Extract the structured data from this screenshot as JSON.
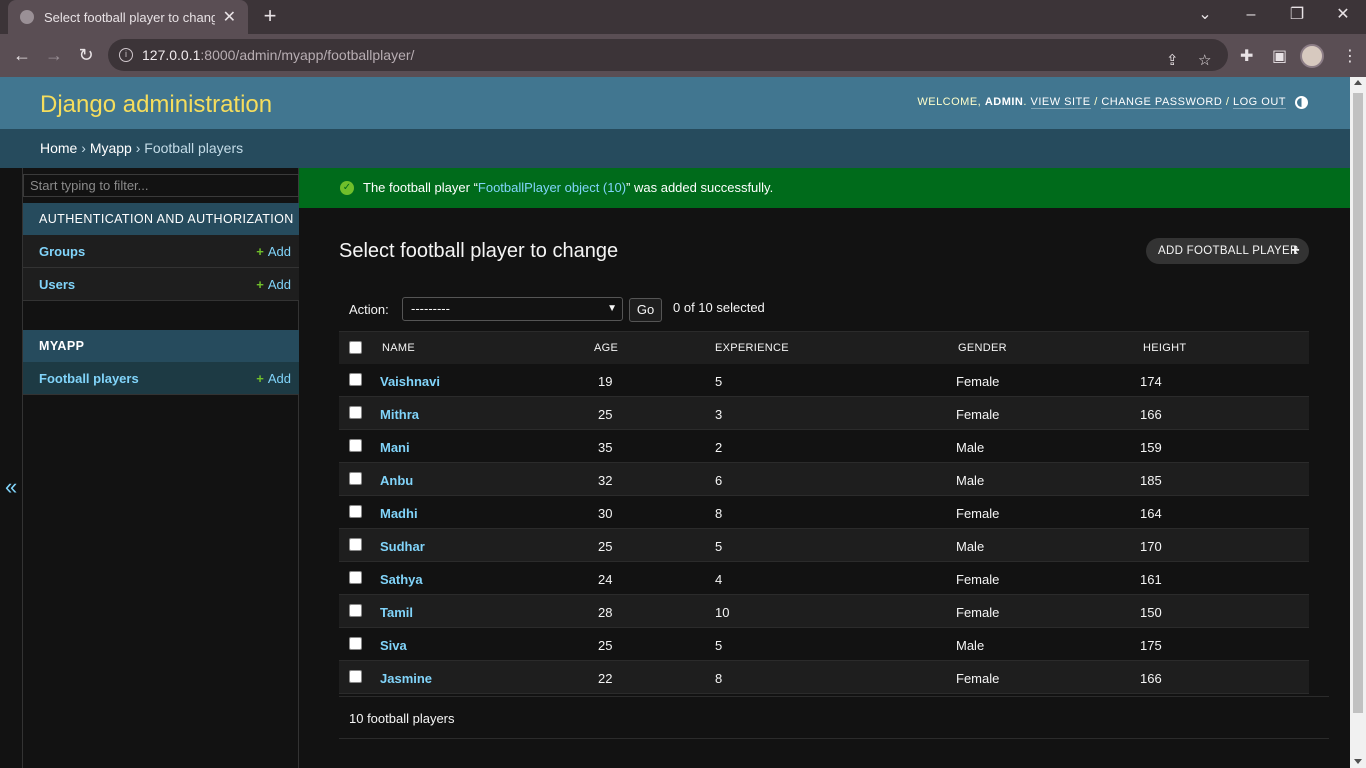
{
  "browser": {
    "tab_title": "Select football player to change",
    "url_host": "127.0.0.1",
    "url_path": ":8000/admin/myapp/footballplayer/"
  },
  "header": {
    "branding": "Django administration",
    "welcome": "WELCOME,",
    "username": "ADMIN",
    "view_site": "VIEW SITE",
    "change_password": "CHANGE PASSWORD",
    "logout": "LOG OUT",
    "sep": "/"
  },
  "breadcrumbs": {
    "home": "Home",
    "app": "Myapp",
    "current": "Football players",
    "sep": "›"
  },
  "sidebar": {
    "filter_placeholder": "Start typing to filter...",
    "toggle_glyph": "«",
    "modules": [
      {
        "caption": "AUTHENTICATION AND AUTHORIZATION",
        "rows": [
          {
            "name": "Groups",
            "add": "Add"
          },
          {
            "name": "Users",
            "add": "Add"
          }
        ]
      },
      {
        "caption": "MYAPP",
        "rows": [
          {
            "name": "Football players",
            "add": "Add"
          }
        ]
      }
    ]
  },
  "message": {
    "prefix": "The football player “",
    "link": "FootballPlayer object (10)",
    "suffix": "” was added successfully."
  },
  "main": {
    "title": "Select football player to change",
    "add_button": "ADD FOOTBALL PLAYER",
    "action_label": "Action:",
    "action_value": "---------",
    "go": "Go",
    "selected_count": "0 of 10 selected",
    "columns": [
      "NAME",
      "AGE",
      "EXPERIENCE",
      "GENDER",
      "HEIGHT"
    ],
    "rows": [
      {
        "name": "Vaishnavi",
        "age": "19",
        "experience": "5",
        "gender": "Female",
        "height": "174"
      },
      {
        "name": "Mithra",
        "age": "25",
        "experience": "3",
        "gender": "Female",
        "height": "166"
      },
      {
        "name": "Mani",
        "age": "35",
        "experience": "2",
        "gender": "Male",
        "height": "159"
      },
      {
        "name": "Anbu",
        "age": "32",
        "experience": "6",
        "gender": "Male",
        "height": "185"
      },
      {
        "name": "Madhi",
        "age": "30",
        "experience": "8",
        "gender": "Female",
        "height": "164"
      },
      {
        "name": "Sudhar",
        "age": "25",
        "experience": "5",
        "gender": "Male",
        "height": "170"
      },
      {
        "name": "Sathya",
        "age": "24",
        "experience": "4",
        "gender": "Female",
        "height": "161"
      },
      {
        "name": "Tamil",
        "age": "28",
        "experience": "10",
        "gender": "Female",
        "height": "150"
      },
      {
        "name": "Siva",
        "age": "25",
        "experience": "5",
        "gender": "Male",
        "height": "175"
      },
      {
        "name": "Jasmine",
        "age": "22",
        "experience": "8",
        "gender": "Female",
        "height": "166"
      }
    ],
    "paginator": "10 football players"
  },
  "colors": {
    "header": "#417690",
    "breadcrumbs": "#264b5d",
    "branding": "#f5dd5d",
    "link": "#81d4fa",
    "success": "#006b1b",
    "add_plus": "#70bf2b"
  }
}
